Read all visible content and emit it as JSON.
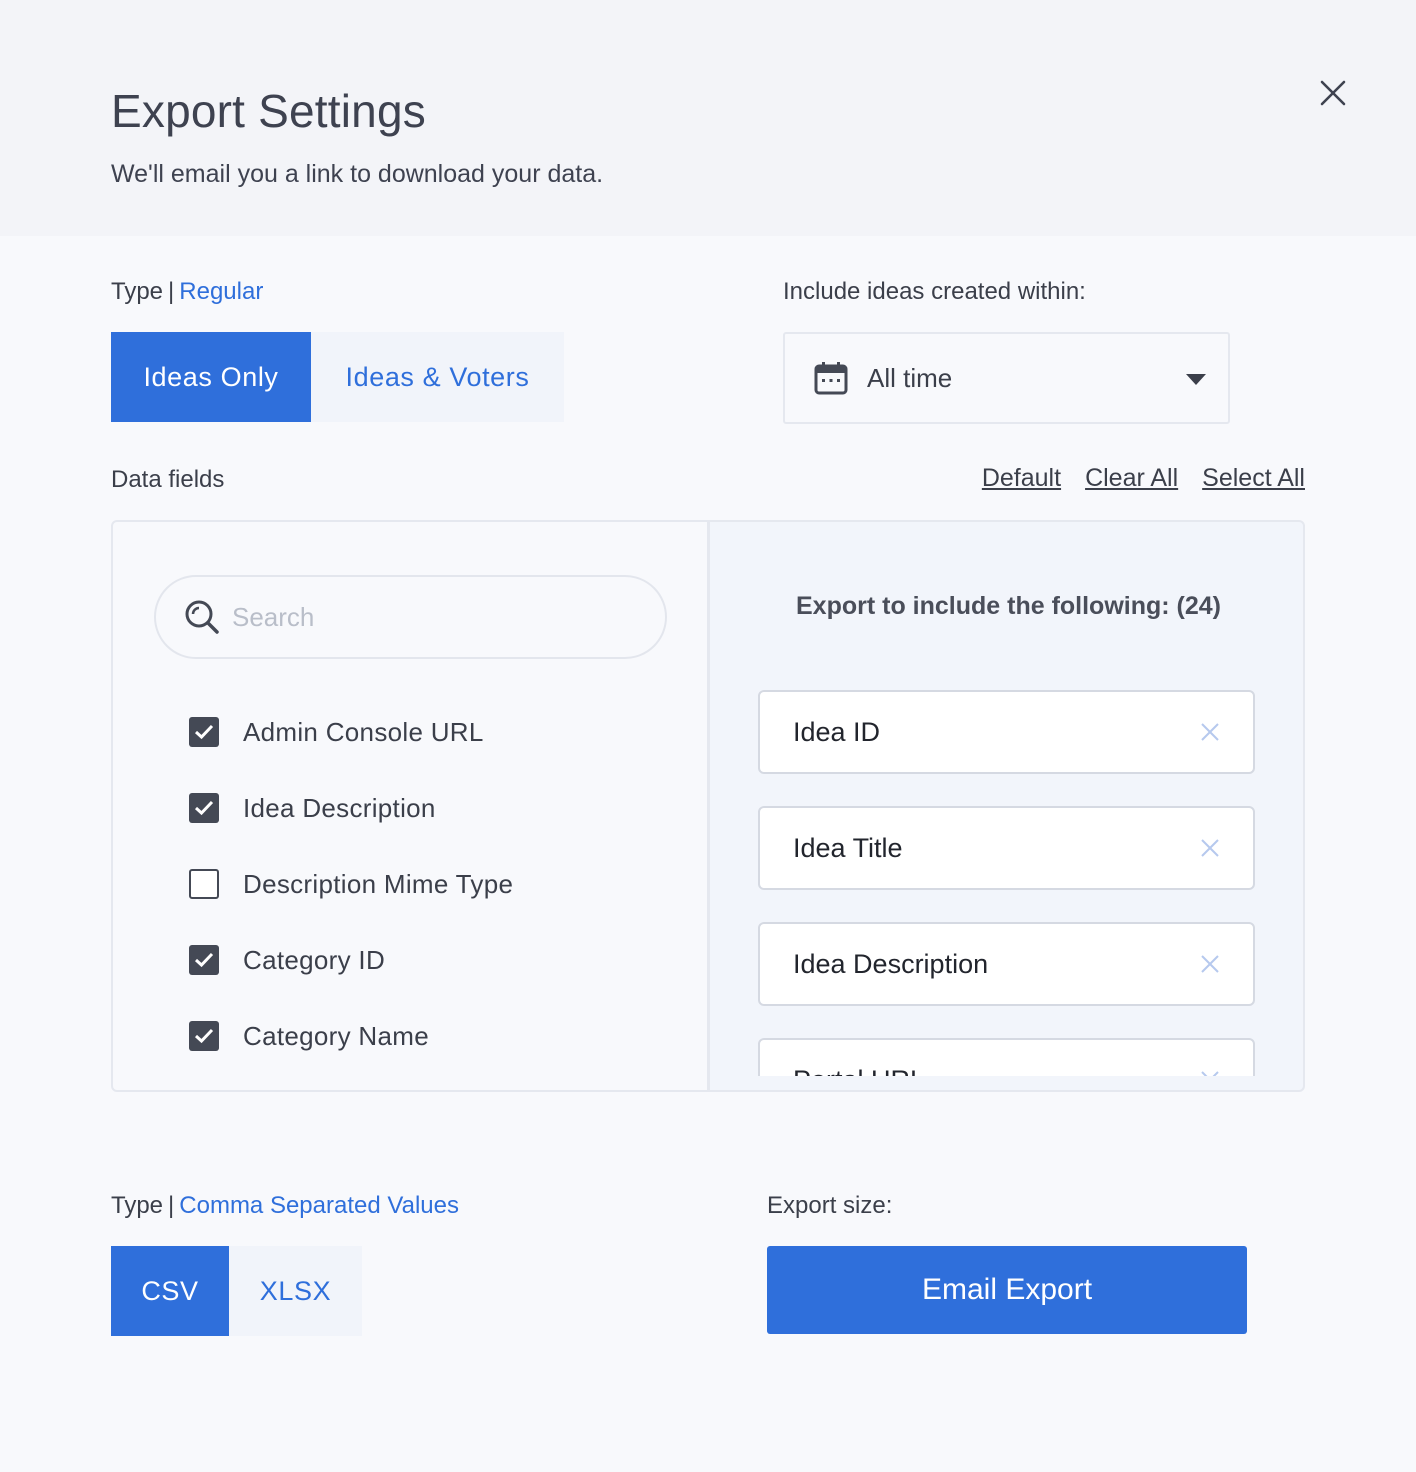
{
  "header": {
    "title": "Export Settings",
    "subtitle": "We'll email you a link to download your data."
  },
  "export_type": {
    "label": "Type",
    "separator": "|",
    "value": "Regular",
    "options": [
      {
        "label": "Ideas Only",
        "active": true
      },
      {
        "label": "Ideas & Voters",
        "active": false
      }
    ]
  },
  "date_filter": {
    "label": "Include ideas created within:",
    "value": "All time"
  },
  "data_fields": {
    "label": "Data fields",
    "actions": [
      "Default",
      "Clear All",
      "Select All"
    ],
    "search_placeholder": "Search",
    "items": [
      {
        "label": "Admin Console URL",
        "checked": true
      },
      {
        "label": "Idea Description",
        "checked": true
      },
      {
        "label": "Description Mime Type",
        "checked": false
      },
      {
        "label": "Category ID",
        "checked": true
      },
      {
        "label": "Category Name",
        "checked": true
      }
    ]
  },
  "included": {
    "heading": "Export to include the following: (24)",
    "items": [
      "Idea ID",
      "Idea Title",
      "Idea Description",
      "Portal URL"
    ]
  },
  "file_type": {
    "label": "Type",
    "separator": "|",
    "value": "Comma Separated Values",
    "options": [
      {
        "label": "CSV",
        "active": true
      },
      {
        "label": "XLSX",
        "active": false
      }
    ]
  },
  "export_size": {
    "label": "Export size:"
  },
  "actions": {
    "email_export": "Email Export"
  },
  "colors": {
    "accent": "#2f6fdb",
    "checkbox": "#444955",
    "header_bg": "#f3f4f8"
  }
}
